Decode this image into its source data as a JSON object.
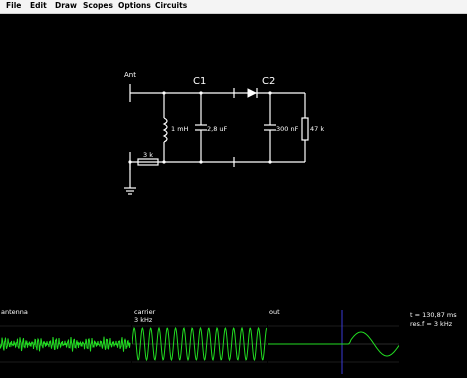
{
  "menu": {
    "file": "File",
    "edit": "Edit",
    "draw": "Draw",
    "scopes": "Scopes",
    "options": "Options",
    "circuits": "Circuits"
  },
  "circuit": {
    "ant_label": "Ant",
    "c1_label": "C1",
    "c2_label": "C2",
    "inductor_value": "1 mH",
    "cap1_value": "2,8 uF",
    "cap2_value": "300 nF",
    "resistor_out_value": "47 k",
    "resistor_in_value": "3 k"
  },
  "scopes": [
    {
      "label_line1": "antenna",
      "label_line2": ""
    },
    {
      "label_line1": "carrier",
      "label_line2": "3 kHz"
    },
    {
      "label_line1": "out",
      "label_line2": ""
    }
  ],
  "info": {
    "time": "t = 130,87 ms",
    "res_freq": "res.f = 3 kHz"
  },
  "colors": {
    "wire": "#ffffff",
    "trace": "#22dd22",
    "scope_grid": "#2a2a2a",
    "cursor": "#3a3ad6"
  }
}
